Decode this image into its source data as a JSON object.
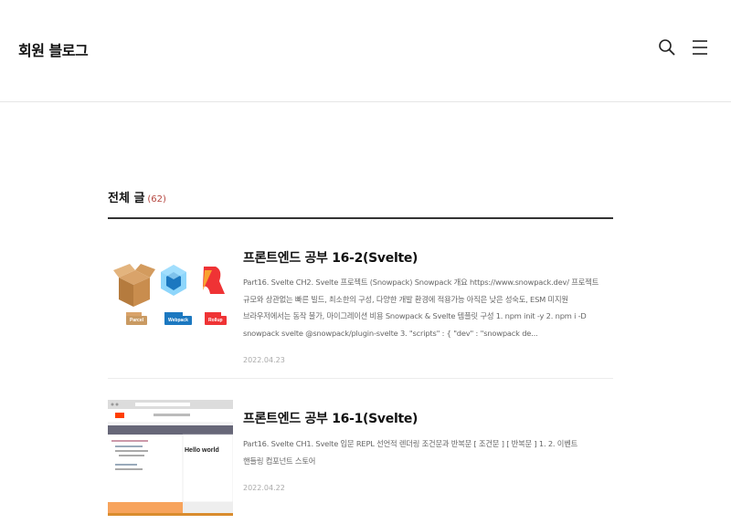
{
  "header": {
    "blog_title": "회원 블로그",
    "icons": [
      "search-icon",
      "menu-icon"
    ]
  },
  "section": {
    "title": "전체 글",
    "count": "(62)"
  },
  "posts": [
    {
      "title": "프론트엔드 공부 16-2(Svelte)",
      "excerpt": "Part16. Svelte CH2. Svelte 프로젝트 (Snowpack) Snowpack 개요 https://www.snowpack.dev/ 프로젝트 규모와 상관없는 빠른 빌드, 최소한의 구성, 다양한 개발 환경에 적용가능 아직은 낮은 성숙도, ESM 미지원 브라우저에서는 동작 불가, 마이그레이션 비용 Snowpack & Svelte 템플릿 구성 1. npm init -y 2. npm i -D snowpack svelte @snowpack/plugin-svelte 3. \"scripts\" : { \"dev\" : \"snowpack de...",
      "date": "2022.04.23",
      "thumb_labels": [
        "Parcel",
        "Webpack",
        "Rollup"
      ]
    },
    {
      "title": "프론트엔드 공부 16-1(Svelte)",
      "excerpt": "Part16. Svelte CH1. Svelte 입문 REPL 선언적 렌더링 조건문과 반복문 [ 조건문 ] [ 반복문 ] 1. 2. 이벤트 핸들링 컴포넌트 스토어",
      "date": "2022.04.22",
      "thumb_text": "Hello world"
    }
  ],
  "colors": {
    "accent_count": "#b5463f",
    "divider": "#333333"
  }
}
